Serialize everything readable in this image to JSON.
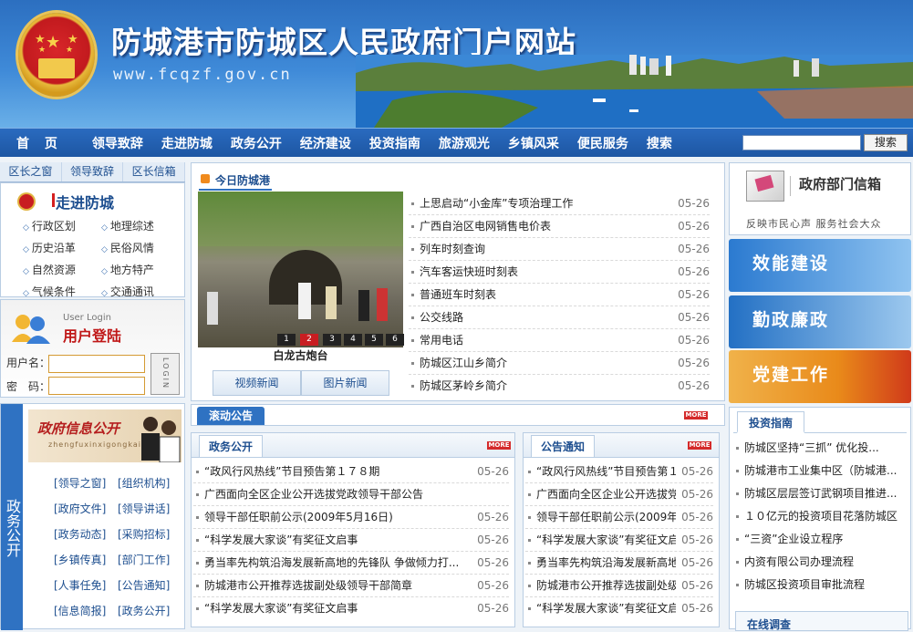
{
  "header": {
    "title": "防城港市防城区人民政府门户网站",
    "url": "www.fcqzf.gov.cn"
  },
  "nav": {
    "items": [
      "首 页",
      "领导致辞",
      "走进防城",
      "政务公开",
      "经济建设",
      "投资指南",
      "旅游观光",
      "乡镇风采",
      "便民服务",
      "搜索"
    ],
    "search_button": "搜索"
  },
  "left": {
    "tabs": [
      "区长之窗",
      "领导致辞",
      "区长信箱"
    ],
    "zoujin": {
      "title": "走进防城",
      "items": [
        "行政区划",
        "地理综述",
        "历史沿革",
        "民俗风情",
        "自然资源",
        "地方特产",
        "气候条件",
        "交通通讯"
      ]
    },
    "login": {
      "en": "User Login",
      "cn": "用户登陆",
      "username_label": "用户名：",
      "password_label": "密　码：",
      "button": "LOGIN"
    },
    "gov_info": {
      "side_label": "政务公开",
      "banner_title": "政府信息公开",
      "banner_pinyin": "zhengfuxinxigongkai",
      "links": [
        "[领导之窗]",
        "[组织机构]",
        "[政府文件]",
        "[领导讲话]",
        "[政务动态]",
        "[采购招标]",
        "[乡镇传真]",
        "[部门工作]",
        "[人事任免]",
        "[公告通知]",
        "[信息简报]",
        "[政务公开]"
      ]
    }
  },
  "center": {
    "today_title": "今日防城港",
    "photo_caption": "白龙古炮台",
    "photo_pages": [
      "1",
      "2",
      "3",
      "4",
      "5",
      "6"
    ],
    "photo_active": "2",
    "video_tabs": [
      "视频新闻",
      "图片新闻"
    ],
    "news": [
      {
        "title": "上思启动“小金库”专项治理工作",
        "date": "05-26"
      },
      {
        "title": "广西自治区电网销售电价表",
        "date": "05-26"
      },
      {
        "title": "列车时刻查询",
        "date": "05-26"
      },
      {
        "title": "汽车客运快班时刻表",
        "date": "05-26"
      },
      {
        "title": "普通班车时刻表",
        "date": "05-26"
      },
      {
        "title": "公交线路",
        "date": "05-26"
      },
      {
        "title": "常用电话",
        "date": "05-26"
      },
      {
        "title": "防城区江山乡简介",
        "date": "05-26"
      },
      {
        "title": "防城区茅岭乡简介",
        "date": "05-26"
      }
    ],
    "notice_label": "滚动公告",
    "more_label": "MORE",
    "zwgk": {
      "title": "政务公开",
      "items": [
        {
          "title": "“政风行风热线”节目预告第１７８期",
          "date": "05-26"
        },
        {
          "title": "广西面向全区企业公开选拔党政领导干部公告",
          "date": ""
        },
        {
          "title": "领导干部任职前公示(2009年5月16日)",
          "date": "05-26"
        },
        {
          "title": "“科学发展大家谈”有奖征文启事",
          "date": "05-26"
        },
        {
          "title": "勇当率先构筑沿海发展新高地的先锋队 争做倾力打...",
          "date": "05-26"
        },
        {
          "title": "防城港市公开推荐选拔副处级领导干部简章",
          "date": "05-26"
        },
        {
          "title": "“科学发展大家谈”有奖征文启事",
          "date": "05-26"
        }
      ]
    },
    "ggtz": {
      "title": "公告通知",
      "items": [
        {
          "title": "“政风行风热线”节目预告第１７...",
          "date": "05-26"
        },
        {
          "title": "广西面向全区企业公开选拔党政领...",
          "date": "05-26"
        },
        {
          "title": "领导干部任职前公示(2009年5月16...",
          "date": "05-26"
        },
        {
          "title": "“科学发展大家谈”有奖征文启事",
          "date": "05-26"
        },
        {
          "title": "勇当率先构筑沿海发展新高地的先...",
          "date": "05-26"
        },
        {
          "title": "防城港市公开推荐选拔副处级领导...",
          "date": "05-26"
        },
        {
          "title": "“科学发展大家谈”有奖征文启事",
          "date": "05-26"
        }
      ]
    }
  },
  "right": {
    "mailbox_title": "政府部门信箱",
    "mailbox_slogan": "反映市民心声 服务社会大众",
    "promos": [
      "效能建设",
      "勤政廉政",
      "党建工作"
    ],
    "colors": {
      "promo1": "#2b7ad0",
      "promo2": "#2370c4",
      "promo3": "#e98a1a"
    },
    "invest": {
      "title": "投资指南",
      "items": [
        "防城区坚持“三抓” 优化投...",
        "防城港市工业集中区（防城港...",
        "防城区层层签订武钢项目推进...",
        "１０亿元的投资项目花落防城区",
        "“三资”企业设立程序",
        "内资有限公司办理流程",
        "防城区投资项目审批流程"
      ]
    },
    "survey_title": "在线调查"
  }
}
